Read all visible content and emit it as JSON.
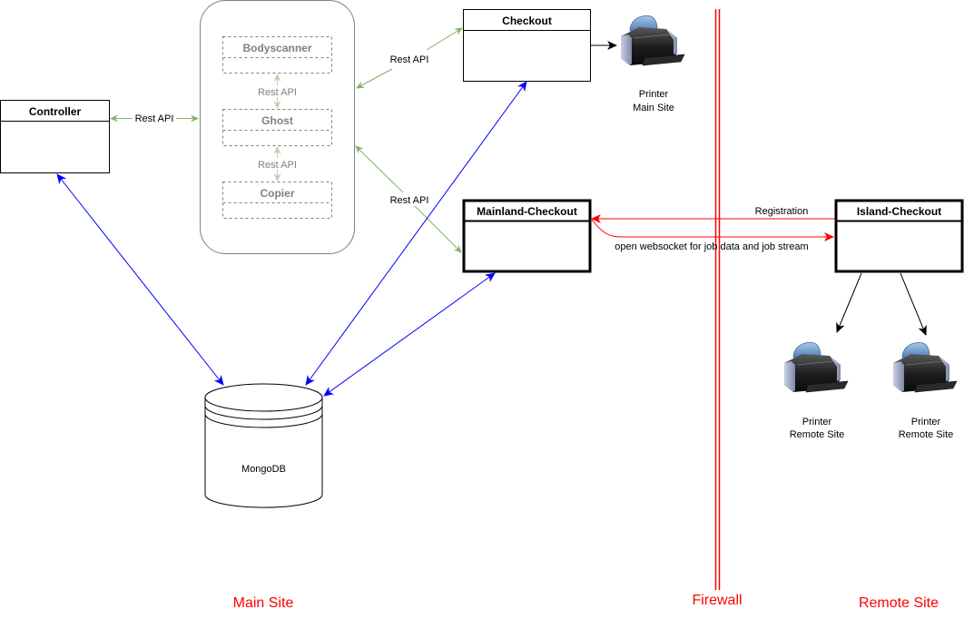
{
  "colors": {
    "green_link": "#82b366",
    "blue_link": "#0000ff",
    "red_link": "#ff0000",
    "grey": "#808080",
    "black": "#000000"
  },
  "nodes": {
    "controller": "Controller",
    "checkout": "Checkout",
    "mainland_checkout": "Mainland-Checkout",
    "island_checkout": "Island-Checkout",
    "mongodb": "MongoDB",
    "group": {
      "bodyscanner": "Bodyscanner",
      "ghost": "Ghost",
      "copier": "Copier",
      "inner_link_1": "Rest API",
      "inner_link_2": "Rest API"
    }
  },
  "printers": {
    "main": {
      "line1": "Printer",
      "line2": "Main Site"
    },
    "remote_1": {
      "line1": "Printer",
      "line2": "Remote Site"
    },
    "remote_2": {
      "line1": "Printer",
      "line2": "Remote Site"
    }
  },
  "edges": {
    "controller_group": "Rest API",
    "group_checkout": "Rest API",
    "group_mainland": "Rest API",
    "registration": "Registration",
    "websocket": "open websocket for job data and job stream"
  },
  "zones": {
    "main_site": "Main Site",
    "firewall": "Firewall",
    "remote_site": "Remote Site"
  }
}
